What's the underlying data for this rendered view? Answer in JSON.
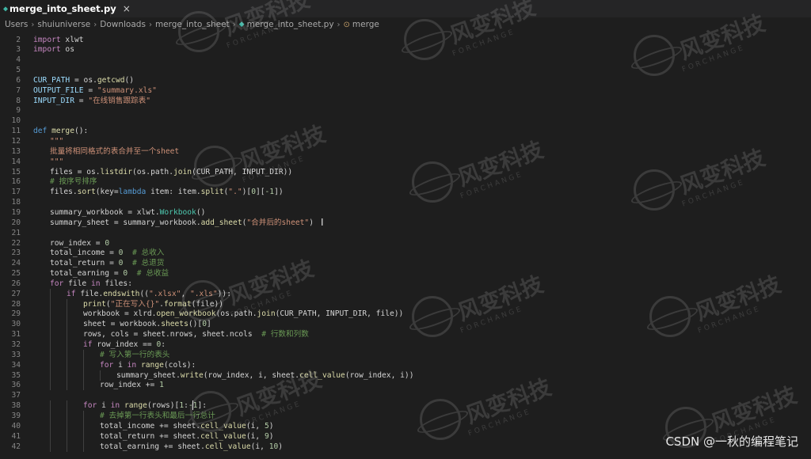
{
  "tab": {
    "icon": "python-file-icon",
    "label": "merge_into_sheet.py",
    "close": "×"
  },
  "breadcrumb": {
    "items": [
      "Users",
      "shuiuniverse",
      "Downloads",
      "merge_into_sheet",
      "merge_into_sheet.py",
      "merge"
    ],
    "separator": "›"
  },
  "watermark": {
    "text": "风变科技",
    "sub": "FORCHANGE"
  },
  "footer": {
    "credit": "CSDN @一秋的编程笔记"
  },
  "code_lines": [
    {
      "n": 2,
      "indent": 0,
      "html": "<span class='kw'>import</span> xlwt"
    },
    {
      "n": 3,
      "indent": 0,
      "html": "<span class='kw'>import</span> os"
    },
    {
      "n": 4,
      "indent": 0,
      "html": ""
    },
    {
      "n": 5,
      "indent": 0,
      "html": ""
    },
    {
      "n": 6,
      "indent": 0,
      "html": "<span class='var'>CUR_PATH</span> = os.<span class='fn'>getcwd</span>()"
    },
    {
      "n": 7,
      "indent": 0,
      "html": "<span class='var'>OUTPUT_FILE</span> = <span class='str'>\"summary.xls\"</span>"
    },
    {
      "n": 8,
      "indent": 0,
      "html": "<span class='var'>INPUT_DIR</span> = <span class='str'>\"在线销售跟踪表\"</span>"
    },
    {
      "n": 9,
      "indent": 0,
      "html": ""
    },
    {
      "n": 10,
      "indent": 0,
      "html": ""
    },
    {
      "n": 11,
      "indent": 0,
      "html": "<span class='kw2'>def</span> <span class='fn'>merge</span>():"
    },
    {
      "n": 12,
      "indent": 1,
      "html": "<span class='str'>\"\"\"</span>"
    },
    {
      "n": 13,
      "indent": 1,
      "html": "<span class='str'>批量将相同格式的表合并至一个sheet</span>"
    },
    {
      "n": 14,
      "indent": 1,
      "html": "<span class='str'>\"\"\"</span>"
    },
    {
      "n": 15,
      "indent": 1,
      "html": "files = os.<span class='fn'>listdir</span>(os.path.<span class='fn'>join</span>(CUR_PATH, INPUT_DIR))"
    },
    {
      "n": 16,
      "indent": 1,
      "html": "<span class='cm'># 按序号排序</span>"
    },
    {
      "n": 17,
      "indent": 1,
      "html": "files.<span class='fn'>sort</span>(key=<span class='kw2'>lambda</span> item: item.<span class='fn'>split</span>(<span class='str'>\".\"</span>)[<span class='num'>0</span>][<span class='num'>-1</span>])"
    },
    {
      "n": 18,
      "indent": 0,
      "html": ""
    },
    {
      "n": 19,
      "indent": 1,
      "html": "summary_workbook = xlwt.<span class='cls'>Workbook</span>()"
    },
    {
      "n": 20,
      "indent": 1,
      "html": "summary_sheet = summary_workbook.<span class='fn'>add_sheet</span>(<span class='str'>\"合并后的sheet\"</span>)"
    },
    {
      "n": 21,
      "indent": 0,
      "html": ""
    },
    {
      "n": 22,
      "indent": 1,
      "html": "row_index = <span class='num'>0</span>"
    },
    {
      "n": 23,
      "indent": 1,
      "html": "total_income = <span class='num'>0</span>  <span class='cm'># 总收入</span>"
    },
    {
      "n": 24,
      "indent": 1,
      "html": "total_return = <span class='num'>0</span>  <span class='cm'># 总退货</span>"
    },
    {
      "n": 25,
      "indent": 1,
      "html": "total_earning = <span class='num'>0</span>  <span class='cm'># 总收益</span>"
    },
    {
      "n": 26,
      "indent": 1,
      "html": "<span class='kw'>for</span> file <span class='kw'>in</span> files:"
    },
    {
      "n": 27,
      "indent": 2,
      "html": "<span class='kw'>if</span> file.<span class='fn'>endswith</span>((<span class='str'>\".xlsx\"</span>, <span class='str'>\".xls\"</span>)):"
    },
    {
      "n": 28,
      "indent": 3,
      "html": "<span class='fn'>print</span>(<span class='str'>\"正在写入{}\"</span>.<span class='fn'>format</span>(file))"
    },
    {
      "n": 29,
      "indent": 3,
      "html": "workbook = xlrd.<span class='fn'>open_workbook</span>(os.path.<span class='fn'>join</span>(CUR_PATH, INPUT_DIR, file))"
    },
    {
      "n": 30,
      "indent": 3,
      "html": "sheet = workbook.<span class='fn'>sheets</span>()[<span class='num'>0</span>]"
    },
    {
      "n": 31,
      "indent": 3,
      "html": "rows, cols = sheet.nrows, sheet.ncols  <span class='cm'># 行数和列数</span>"
    },
    {
      "n": 32,
      "indent": 3,
      "html": "<span class='kw'>if</span> row_index == <span class='num'>0</span>:"
    },
    {
      "n": 33,
      "indent": 4,
      "html": "<span class='cm'># 写入第一行的表头</span>"
    },
    {
      "n": 34,
      "indent": 4,
      "html": "<span class='kw'>for</span> i <span class='kw'>in</span> <span class='fn'>range</span>(cols):"
    },
    {
      "n": 35,
      "indent": 5,
      "html": "summary_sheet.<span class='fn'>write</span>(row_index, i, sheet.<span class='fn'>cell_value</span>(row_index, i))"
    },
    {
      "n": 36,
      "indent": 4,
      "html": "row_index += <span class='num'>1</span>"
    },
    {
      "n": 37,
      "indent": 0,
      "html": ""
    },
    {
      "n": 38,
      "indent": 3,
      "html": "<span class='kw'>for</span> i <span class='kw'>in</span> <span class='fn'>range</span>(rows)[<span class='num'>1</span>:<span class='num'>-1</span>]:"
    },
    {
      "n": 39,
      "indent": 4,
      "html": "<span class='cm'># 去掉第一行表头和最后一行总计</span>"
    },
    {
      "n": 40,
      "indent": 4,
      "html": "total_income += sheet.<span class='fn'>cell_value</span>(i, <span class='num'>5</span>)"
    },
    {
      "n": 41,
      "indent": 4,
      "html": "total_return += sheet.<span class='fn'>cell_value</span>(i, <span class='num'>9</span>)"
    },
    {
      "n": 42,
      "indent": 4,
      "html": "total_earning += sheet.<span class='fn'>cell_value</span>(i, <span class='num'>10</span>)"
    }
  ]
}
